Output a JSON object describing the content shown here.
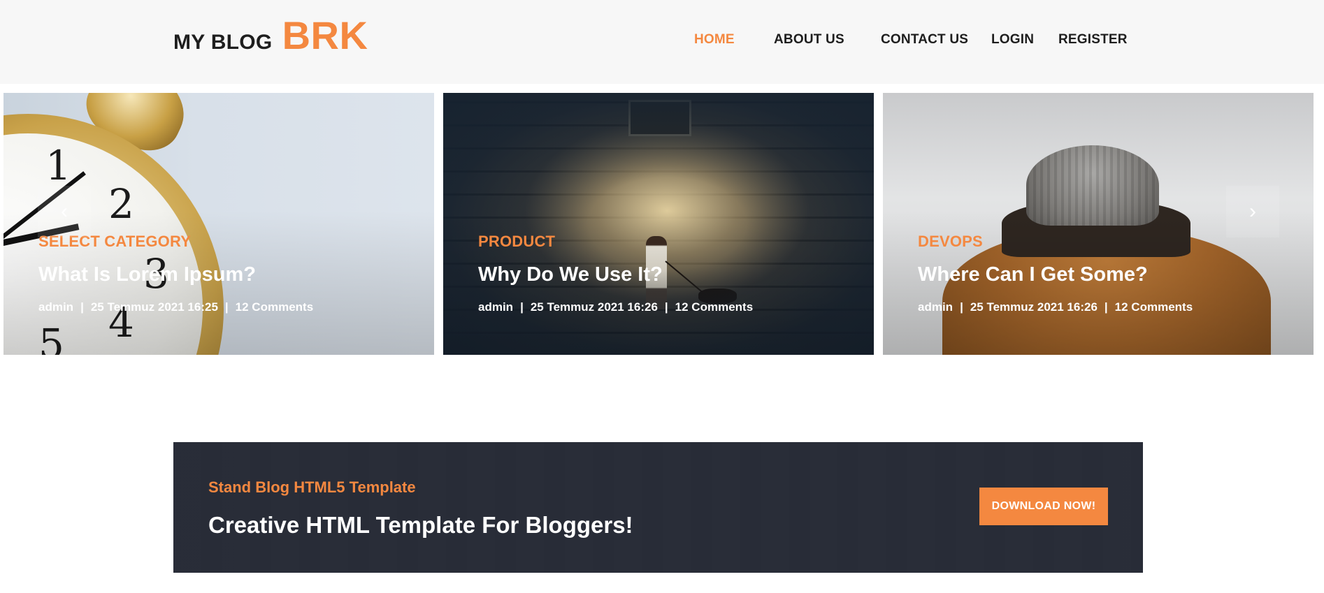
{
  "header": {
    "logo_main": "MY BLOG",
    "logo_accent": "BRK",
    "nav": [
      {
        "label": "HOME",
        "active": true
      },
      {
        "label": "ABOUT US",
        "active": false
      },
      {
        "label": "CONTACT US",
        "active": false
      },
      {
        "label": "LOGIN",
        "active": false
      },
      {
        "label": "REGISTER",
        "active": false
      }
    ]
  },
  "slider": {
    "prev_icon": "‹",
    "next_icon": "›",
    "slides": [
      {
        "category": "SELECT CATEGORY",
        "title": "What Is Lorem Ipsum?",
        "author": "admin",
        "date": "25 Temmuz 2021 16:25",
        "comments": "12 Comments",
        "image": "alarm-clock-photo"
      },
      {
        "category": "PRODUCT",
        "title": "Why Do We Use It?",
        "author": "admin",
        "date": "25 Temmuz 2021 16:26",
        "comments": "12 Comments",
        "image": "person-walking-dog-photo"
      },
      {
        "category": "DEVOPS",
        "title": "Where Can I Get Some?",
        "author": "admin",
        "date": "25 Temmuz 2021 16:26",
        "comments": "12 Comments",
        "image": "person-in-beanie-photo"
      }
    ],
    "separator": "|"
  },
  "cta": {
    "subtitle": "Stand Blog HTML5 Template",
    "title": "Creative HTML Template For Bloggers!",
    "button_label": "DOWNLOAD NOW!"
  },
  "colors": {
    "accent": "#f48840",
    "header_bg": "#f7f7f7",
    "text_dark": "#1e1e1e",
    "cta_bg": "#282c37"
  }
}
